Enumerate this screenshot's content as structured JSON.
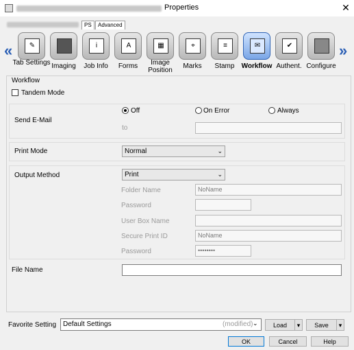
{
  "window": {
    "title": "Properties",
    "close_glyph": "✕"
  },
  "tabs": [
    {
      "label": "PS"
    },
    {
      "label": "Advanced"
    }
  ],
  "nav": {
    "left_arrow": "«",
    "right_arrow": "»"
  },
  "ribbon": [
    {
      "label": "Tab Settings",
      "icon": "tab-settings-icon"
    },
    {
      "label": "Imaging",
      "icon": "imaging-icon"
    },
    {
      "label": "Job Info",
      "icon": "job-info-icon"
    },
    {
      "label": "Forms",
      "icon": "forms-icon"
    },
    {
      "label": "Image Position",
      "icon": "image-position-icon"
    },
    {
      "label": "Marks",
      "icon": "marks-icon"
    },
    {
      "label": "Stamp",
      "icon": "stamp-icon"
    },
    {
      "label": "Workflow",
      "icon": "workflow-icon",
      "active": true
    },
    {
      "label": "Authent.",
      "icon": "authentication-icon"
    },
    {
      "label": "Configure",
      "icon": "configure-icon"
    }
  ],
  "workflow": {
    "group_label": "Workflow",
    "tandem_mode": {
      "label": "Tandem Mode",
      "checked": false
    },
    "send_email": {
      "label": "Send E-Mail",
      "options": [
        "Off",
        "On Error",
        "Always"
      ],
      "selected": "Off",
      "to_label": "to",
      "to_value": ""
    },
    "print_mode": {
      "label": "Print Mode",
      "value": "Normal"
    },
    "output_method": {
      "label": "Output Method",
      "value": "Print",
      "folder_name_label": "Folder Name",
      "folder_name_value": "NoName",
      "password_label": "Password",
      "password_value": "",
      "user_box_name_label": "User Box Name",
      "user_box_name_value": "",
      "secure_print_id_label": "Secure Print ID",
      "secure_print_id_value": "NoName",
      "password2_label": "Password",
      "password2_value": "••••••••"
    },
    "file_name": {
      "label": "File Name",
      "value": ""
    }
  },
  "favorite": {
    "label": "Favorite Setting",
    "value": "Default Settings",
    "status": "(modified)",
    "load_label": "Load",
    "save_label": "Save"
  },
  "dialog_buttons": {
    "ok": "OK",
    "cancel": "Cancel",
    "help": "Help"
  },
  "colors": {
    "accent": "#2b5fb5",
    "active_tab": "#7aa6e6"
  }
}
